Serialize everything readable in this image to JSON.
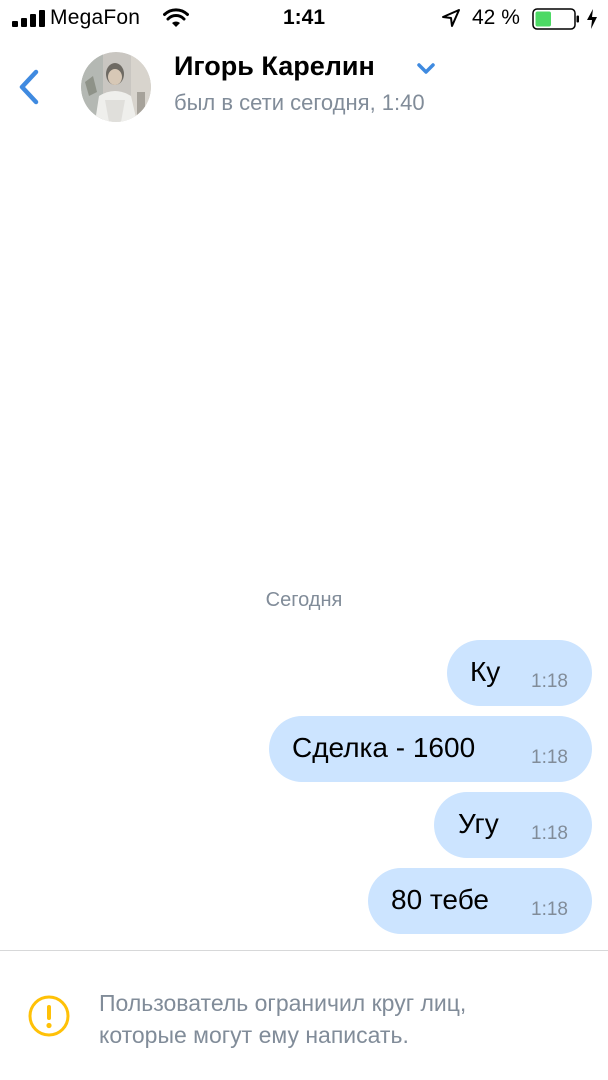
{
  "status_bar": {
    "carrier": "MegaFon",
    "time": "1:41",
    "battery_percent": "42 %",
    "battery_level": 0.42,
    "icons": [
      "signal-icon",
      "wifi-icon",
      "location-icon",
      "battery-icon",
      "charging-icon"
    ]
  },
  "header": {
    "contact_name": "Игорь Карелин",
    "last_seen": "был в сети сегодня, 1:40",
    "icons": [
      "back-chevron-icon",
      "chevron-down-icon"
    ]
  },
  "chat": {
    "date_label": "Сегодня",
    "messages": [
      {
        "text": "Ку",
        "time": "1:18"
      },
      {
        "text": "Сделка - 1600",
        "time": "1:18"
      },
      {
        "text": "Угу",
        "time": "1:18"
      },
      {
        "text": "80 тебе",
        "time": "1:18"
      }
    ]
  },
  "footer": {
    "notice": "Пользователь ограничил круг лиц,\nкоторые могут ему написать.",
    "icon": "warning-icon"
  },
  "colors": {
    "accent": "#3f8ae0",
    "bubble_outgoing": "#cce4ff",
    "secondary_text": "#818c99",
    "warning": "#ffc107",
    "battery_fill": "#4cd964"
  }
}
